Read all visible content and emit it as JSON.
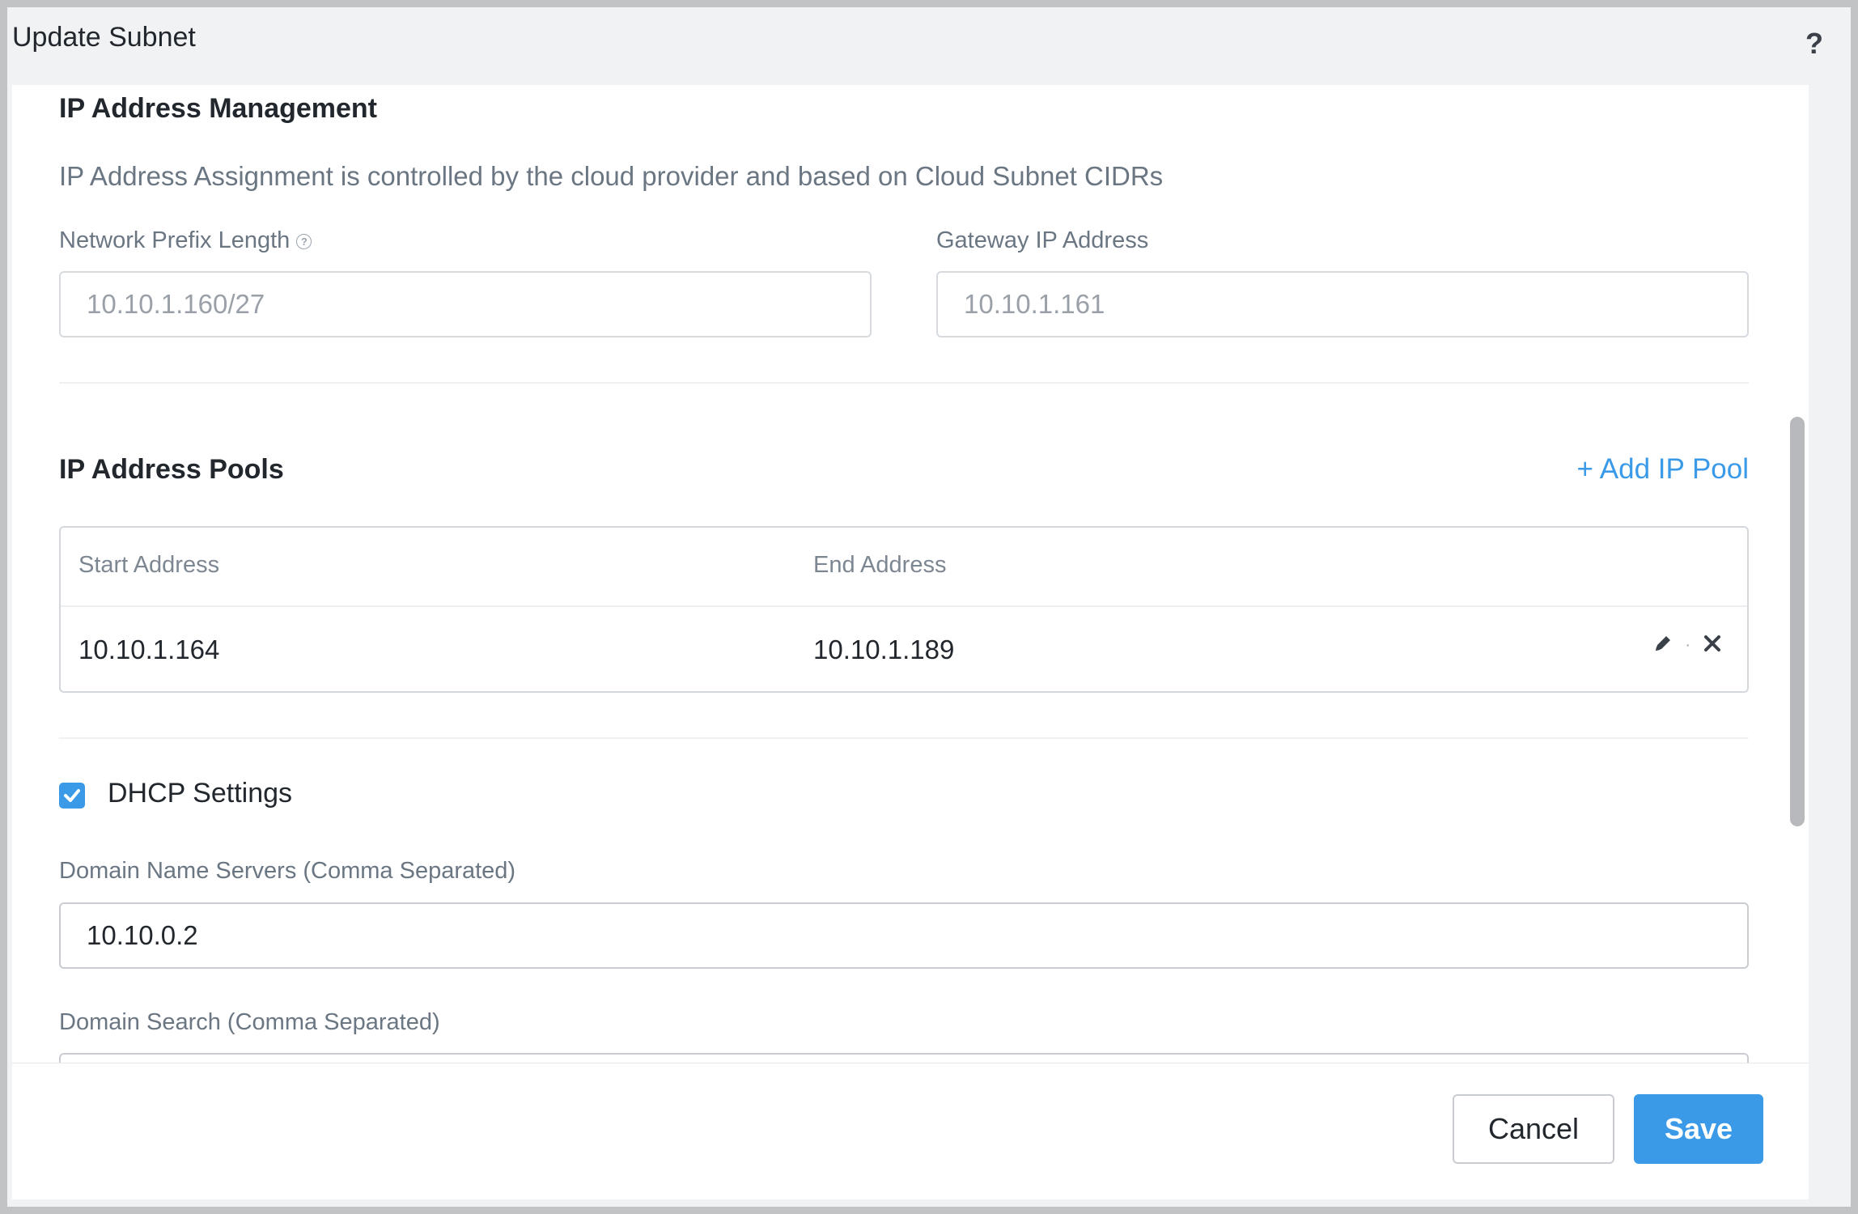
{
  "dialog": {
    "title": "Update Subnet",
    "help_icon": "?"
  },
  "ipam": {
    "title": "IP Address Management",
    "subtitle": "IP Address Assignment is controlled by the cloud provider and based on Cloud Subnet CIDRs",
    "prefix_label": "Network Prefix Length",
    "prefix_value": "10.10.1.160/27",
    "gateway_label": "Gateway IP Address",
    "gateway_value": "10.10.1.161"
  },
  "pools": {
    "title": "IP Address Pools",
    "add_label": "+ Add IP Pool",
    "columns": [
      "Start Address",
      "End Address"
    ],
    "rows": [
      {
        "start": "10.10.1.164",
        "end": "10.10.1.189"
      }
    ]
  },
  "dhcp": {
    "label": "DHCP Settings",
    "checked": true,
    "dns_label": "Domain Name Servers (Comma Separated)",
    "dns_value": "10.10.0.2",
    "search_label": "Domain Search (Comma Separated)"
  },
  "footer": {
    "cancel_label": "Cancel",
    "save_label": "Save"
  },
  "colors": {
    "accent": "#3a9ae8",
    "background": "#f1f2f4",
    "text": "#22272e",
    "muted": "#6b7683"
  }
}
